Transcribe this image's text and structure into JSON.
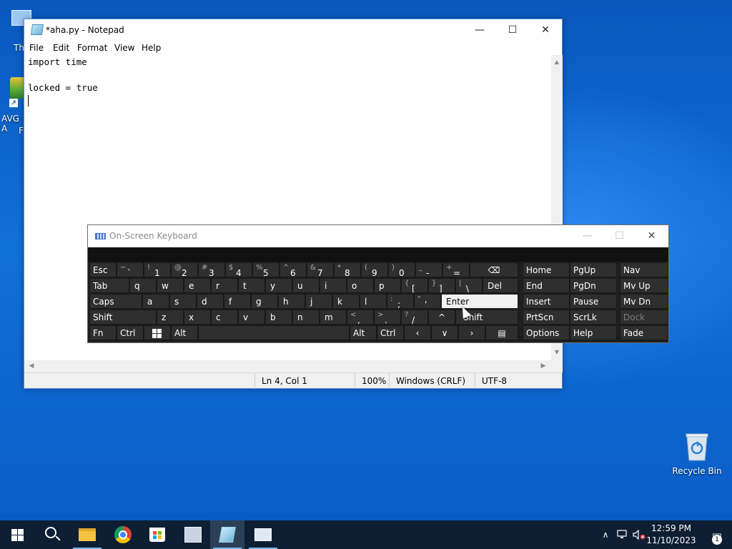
{
  "desktop": {
    "icons": [
      {
        "name": "This PC",
        "label": "Th"
      },
      {
        "name": "AVG Antivirus",
        "label": "AVG A",
        "label2": "F"
      },
      {
        "name": "Recycle Bin",
        "label": "Recycle Bin"
      }
    ]
  },
  "notepad": {
    "title": "*aha.py - Notepad",
    "min_glyph": "—",
    "max_glyph": "☐",
    "close_glyph": "✕",
    "menu": [
      "File",
      "Edit",
      "Format",
      "View",
      "Help"
    ],
    "lines": [
      "import time",
      "",
      "locked = true",
      ""
    ],
    "status": {
      "position": "Ln 4, Col 1",
      "zoom": "100%",
      "line_ending": "Windows (CRLF)",
      "encoding": "UTF-8"
    }
  },
  "osk": {
    "title": "On-Screen Keyboard",
    "min_glyph": "—",
    "max_glyph": "☐",
    "close_glyph": "✕",
    "row1": {
      "esc": "Esc",
      "tilde": {
        "shift": "~",
        "main": "`"
      },
      "digits": [
        {
          "shift": "!",
          "main": "1"
        },
        {
          "shift": "@",
          "main": "2"
        },
        {
          "shift": "#",
          "main": "3"
        },
        {
          "shift": "$",
          "main": "4"
        },
        {
          "shift": "%",
          "main": "5"
        },
        {
          "shift": "^",
          "main": "6"
        },
        {
          "shift": "&",
          "main": "7"
        },
        {
          "shift": "*",
          "main": "8"
        },
        {
          "shift": "(",
          "main": "9"
        },
        {
          "shift": ")",
          "main": "0"
        },
        {
          "shift": "_",
          "main": "-"
        },
        {
          "shift": "+",
          "main": "="
        }
      ],
      "backspace": "⌫"
    },
    "row2": {
      "tab": "Tab",
      "letters": [
        "q",
        "w",
        "e",
        "r",
        "t",
        "y",
        "u",
        "i",
        "o",
        "p"
      ],
      "brackets": [
        {
          "shift": "{",
          "main": "["
        },
        {
          "shift": "}",
          "main": "]"
        },
        {
          "shift": "|",
          "main": "\\"
        }
      ],
      "del": "Del"
    },
    "row3": {
      "caps": "Caps",
      "letters": [
        "a",
        "s",
        "d",
        "f",
        "g",
        "h",
        "j",
        "k",
        "l"
      ],
      "punct": [
        {
          "shift": ":",
          "main": ";"
        },
        {
          "shift": "\"",
          "main": "'"
        }
      ],
      "enter": "Enter"
    },
    "row4": {
      "shift_left": "Shift",
      "letters": [
        "z",
        "x",
        "c",
        "v",
        "b",
        "n",
        "m"
      ],
      "punct": [
        {
          "shift": "<",
          "main": ","
        },
        {
          "shift": ">",
          "main": "."
        },
        {
          "shift": "?",
          "main": "/"
        }
      ],
      "up": "^",
      "shift_right": "Shift"
    },
    "row5": {
      "fn": "Fn",
      "ctrl": "Ctrl",
      "alt": "Alt",
      "alt_right": "Alt",
      "ctrl_right": "Ctrl",
      "left": "‹",
      "down": "∨",
      "right": "›",
      "menu": "▤"
    },
    "nav": {
      "home": "Home",
      "pgup": "PgUp",
      "nav": "Nav",
      "end": "End",
      "pgdn": "PgDn",
      "mvup": "Mv Up",
      "insert": "Insert",
      "pause": "Pause",
      "mvdn": "Mv Dn",
      "prtscn": "PrtScn",
      "scrlk": "ScrLk",
      "dock": "Dock",
      "options": "Options",
      "help": "Help",
      "fade": "Fade"
    }
  },
  "taskbar": {
    "apps": [
      "Start",
      "Search",
      "File Explorer",
      "Google Chrome",
      "Microsoft Store",
      "Control Panel",
      "Notepad",
      "On-Screen Keyboard"
    ],
    "tray_chevron": "∧",
    "time": "12:59 PM",
    "date": "11/10/2023",
    "notification_count": "1"
  },
  "colors": {
    "desktop": "#0b63c8",
    "taskbar": "#0e1e33",
    "osk_key": "#2f2f2f",
    "accent": "#76b9ed"
  }
}
